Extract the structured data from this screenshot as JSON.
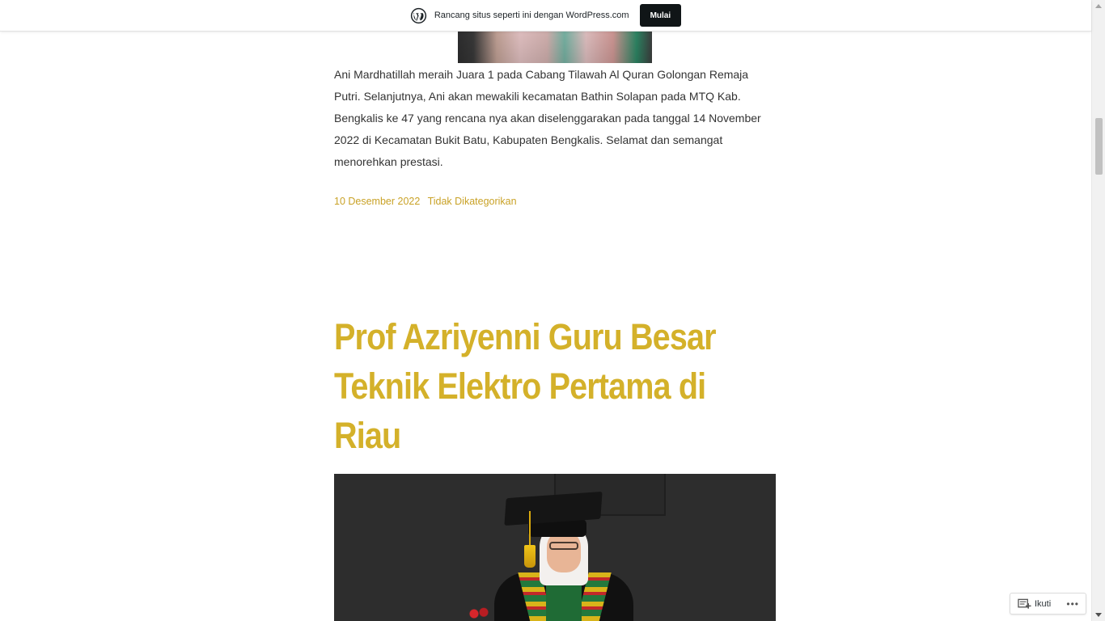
{
  "banner": {
    "text": "Rancang situs seperti ini dengan WordPress.com",
    "button_label": "Mulai",
    "logo_icon": "wordpress-logo-icon"
  },
  "article": {
    "body": "Ani Mardhatillah meraih Juara 1 pada Cabang Tilawah Al Quran Golongan Remaja Putri. Selanjutnya, Ani akan mewakili kecamatan Bathin Solapan pada MTQ Kab. Bengkalis ke 47 yang rencana nya akan diselenggarakan pada tanggal 14 November 2022 di Kecamatan Bukit Batu, Kabupaten Bengkalis.  Selamat dan semangat menorehkan prestasi.",
    "date": "10 Desember 2022",
    "category": "Tidak Dikategorikan"
  },
  "next_post": {
    "title": "Prof Azriyenni Guru Besar Teknik Elektro Pertama di Riau"
  },
  "follow": {
    "label": "Ikuti",
    "more": "•••"
  },
  "colors": {
    "accent": "#d4b12a",
    "meta": "#c9a227",
    "button_bg": "#101517"
  }
}
